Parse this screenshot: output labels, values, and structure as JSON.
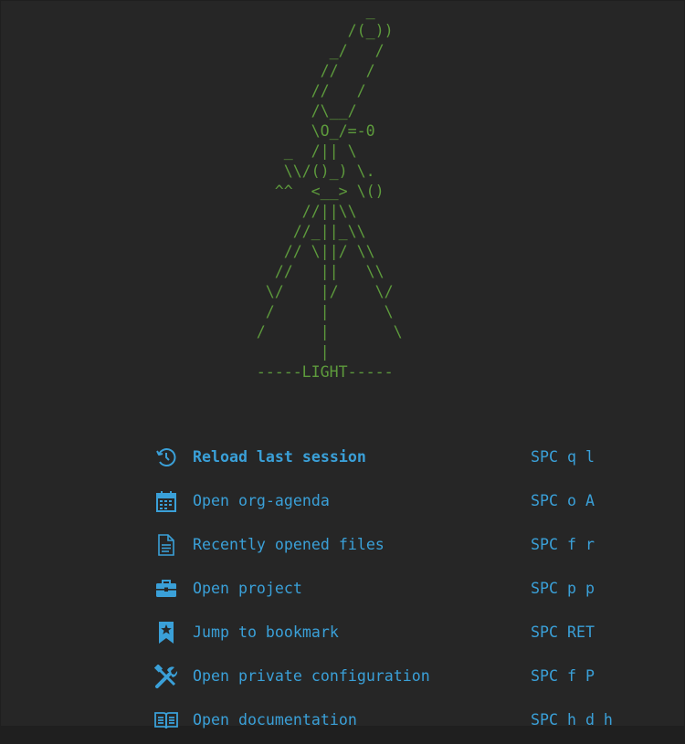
{
  "banner": {
    "art": "                                        _\n                                      /(_))\n                                    _/   /\n                                   //   /\n                                  //   /\n                                  /\\__/\n                                  \\O_/=-0\n                               _  /|| \\\n                               \\\\/()_) \\.\n                              ^^  <__> \\()\n                                 //||\\\\\n                                //_||_\\\\\n                               // \\||/ \\\\\n                              //   ||   \\\\\n                             \\/    |/    \\/\n                             /     |      \\\n                            /      |       \\\n                                   |\n                            -----LIGHT-----"
  },
  "menu": [
    {
      "icon": "reload-icon",
      "label": "Reload last session",
      "keys": "SPC q l",
      "bold": true
    },
    {
      "icon": "calendar-icon",
      "label": "Open org-agenda",
      "keys": "SPC o A",
      "bold": false
    },
    {
      "icon": "file-text-icon",
      "label": "Recently opened files",
      "keys": "SPC f r",
      "bold": false
    },
    {
      "icon": "briefcase-icon",
      "label": "Open project",
      "keys": "SPC p p",
      "bold": false
    },
    {
      "icon": "bookmark-icon",
      "label": "Jump to bookmark",
      "keys": "SPC RET",
      "bold": false
    },
    {
      "icon": "tools-icon",
      "label": "Open private configuration",
      "keys": "SPC f P",
      "bold": false
    },
    {
      "icon": "book-icon",
      "label": "Open documentation",
      "keys": "SPC h d h",
      "bold": false
    }
  ],
  "colors": {
    "background": "#262626",
    "banner": "#5d9a3c",
    "accent": "#3aa0d8"
  }
}
